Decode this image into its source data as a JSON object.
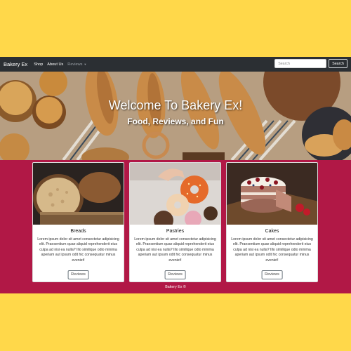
{
  "navbar": {
    "brand": "Bakery Ex",
    "links": [
      "Shop",
      "About Us"
    ],
    "dropdown_label": "Reviews",
    "search_placeholder": "Search",
    "search_button": "Search"
  },
  "hero": {
    "title": "Welcome To Bakery Ex!",
    "subtitle": "Food, Reviews, and Fun"
  },
  "cards": [
    {
      "title": "Breads",
      "text": "Lorem ipsum dolor sit amet consectetur adipisicing elit. Praesentium quae aliquid reprehenderit eius culpa ad nisi ea nulla? Illo similique odio minima aperiam aut ipsum odit hic consequatur minus eveniet!",
      "button": "Reviews"
    },
    {
      "title": "Pastries",
      "text": "Lorem ipsum dolor sit amet consectetur adipisicing elit. Praesentium quae aliquid reprehenderit eius culpa ad nisi ea nulla? Illo similique odio minima aperiam aut ipsum odit hic consequatur minus eveniet!",
      "button": "Reviews"
    },
    {
      "title": "Cakes",
      "text": "Lorem ipsum dolor sit amet consectetur adipisicing elit. Praesentium quae aliquid reprehenderit eius culpa ad nisi ea nulla? Illo similique odio minima aperiam aut ipsum odit hic consequatur minus eveniet!",
      "button": "Reviews"
    }
  ],
  "footer": "Bakery Ex ©",
  "colors": {
    "page_background": "#ffd84a",
    "section_background": "#b11846",
    "navbar": "#2b2f33"
  }
}
